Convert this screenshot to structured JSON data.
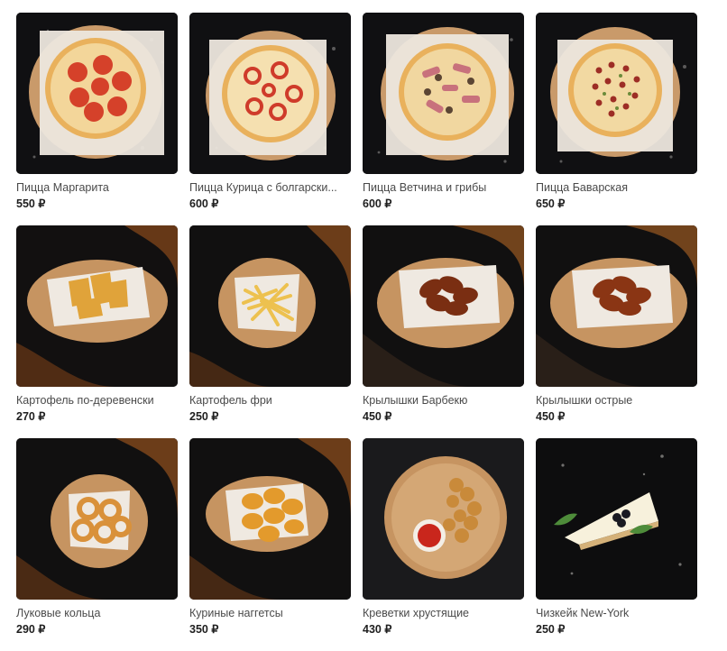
{
  "currency": "₽",
  "products": [
    {
      "title": "Пицца Маргарита",
      "price": "550 ₽",
      "icon": "pizza-margherita",
      "theme": "dark"
    },
    {
      "title": "Пицца Курица с болгарски...",
      "price": "600 ₽",
      "icon": "pizza-chicken-pepper",
      "theme": "dark"
    },
    {
      "title": "Пицца Ветчина и грибы",
      "price": "600 ₽",
      "icon": "pizza-ham-mushroom",
      "theme": "dark"
    },
    {
      "title": "Пицца Баварская",
      "price": "650 ₽",
      "icon": "pizza-bavarian",
      "theme": "dark"
    },
    {
      "title": "Картофель по-деревенски",
      "price": "270 ₽",
      "icon": "potato-wedges",
      "theme": "spice"
    },
    {
      "title": "Картофель фри",
      "price": "250 ₽",
      "icon": "french-fries",
      "theme": "spice"
    },
    {
      "title": "Крылышки Барбекю",
      "price": "450 ₽",
      "icon": "bbq-wings",
      "theme": "spice"
    },
    {
      "title": "Крылышки острые",
      "price": "450 ₽",
      "icon": "spicy-wings",
      "theme": "spice"
    },
    {
      "title": "Луковые кольца",
      "price": "290 ₽",
      "icon": "onion-rings",
      "theme": "spice"
    },
    {
      "title": "Куриные наггетсы",
      "price": "350 ₽",
      "icon": "chicken-nuggets",
      "theme": "spice"
    },
    {
      "title": "Креветки хрустящие",
      "price": "430 ₽",
      "icon": "crispy-shrimp",
      "theme": "plain"
    },
    {
      "title": "Чизкейк New-York",
      "price": "250 ₽",
      "icon": "cheesecake",
      "theme": "plain"
    }
  ],
  "colors": {
    "background": "#ffffff",
    "card_bg": "#0f0f10",
    "title": "#4a4a4a",
    "price": "#1f1f1f",
    "wood": "#c89a64",
    "paper": "#efeae3",
    "spice": "#b8752c"
  }
}
